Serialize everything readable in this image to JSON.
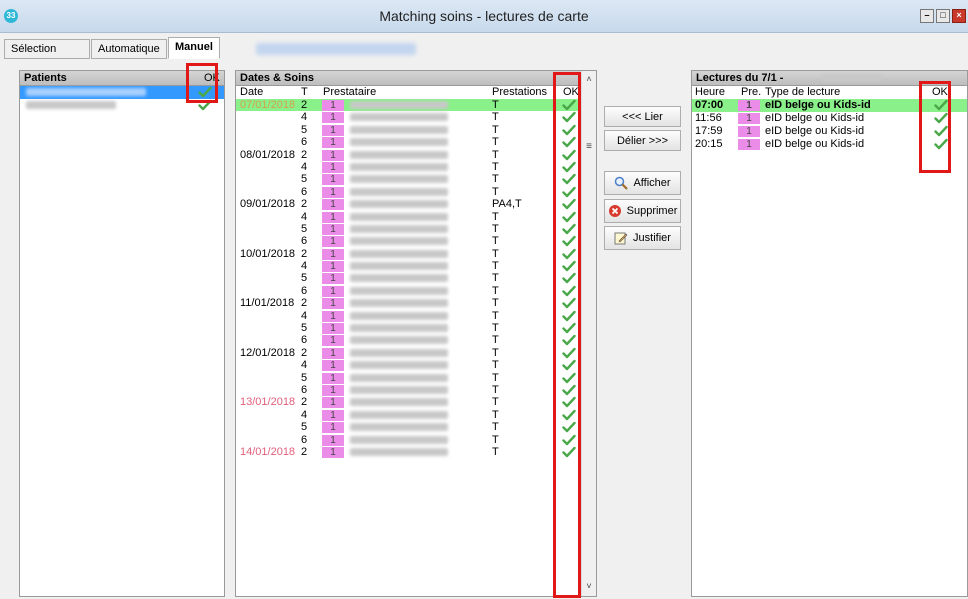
{
  "window": {
    "title": "Matching soins - lectures de carte",
    "icon_label": "33"
  },
  "tabs": [
    {
      "label": "Sélection"
    },
    {
      "label": "Automatique"
    },
    {
      "label": "Manuel",
      "active": true
    }
  ],
  "patients": {
    "header": "Patients",
    "ok_header": "OK",
    "rows": [
      {
        "ok": true,
        "selected": true
      },
      {
        "ok": true,
        "selected": false
      }
    ]
  },
  "soins": {
    "header": "Dates & Soins",
    "columns": {
      "date": "Date",
      "t": "T",
      "prestataire": "Prestataire",
      "prestations": "Prestations",
      "ok": "OK"
    },
    "rows": [
      {
        "date": "07/01/2018",
        "t": "2",
        "pre": "1",
        "prestations": "T",
        "date_color": "#d6a04a",
        "highlight": true
      },
      {
        "date": "",
        "t": "4",
        "pre": "1",
        "prestations": "T"
      },
      {
        "date": "",
        "t": "5",
        "pre": "1",
        "prestations": "T"
      },
      {
        "date": "",
        "t": "6",
        "pre": "1",
        "prestations": "T"
      },
      {
        "date": "08/01/2018",
        "t": "2",
        "pre": "1",
        "prestations": "T"
      },
      {
        "date": "",
        "t": "4",
        "pre": "1",
        "prestations": "T"
      },
      {
        "date": "",
        "t": "5",
        "pre": "1",
        "prestations": "T"
      },
      {
        "date": "",
        "t": "6",
        "pre": "1",
        "prestations": "T"
      },
      {
        "date": "09/01/2018",
        "t": "2",
        "pre": "1",
        "prestations": "PA4,T"
      },
      {
        "date": "",
        "t": "4",
        "pre": "1",
        "prestations": "T"
      },
      {
        "date": "",
        "t": "5",
        "pre": "1",
        "prestations": "T"
      },
      {
        "date": "",
        "t": "6",
        "pre": "1",
        "prestations": "T"
      },
      {
        "date": "10/01/2018",
        "t": "2",
        "pre": "1",
        "prestations": "T"
      },
      {
        "date": "",
        "t": "4",
        "pre": "1",
        "prestations": "T"
      },
      {
        "date": "",
        "t": "5",
        "pre": "1",
        "prestations": "T"
      },
      {
        "date": "",
        "t": "6",
        "pre": "1",
        "prestations": "T"
      },
      {
        "date": "11/01/2018",
        "t": "2",
        "pre": "1",
        "prestations": "T"
      },
      {
        "date": "",
        "t": "4",
        "pre": "1",
        "prestations": "T"
      },
      {
        "date": "",
        "t": "5",
        "pre": "1",
        "prestations": "T"
      },
      {
        "date": "",
        "t": "6",
        "pre": "1",
        "prestations": "T"
      },
      {
        "date": "12/01/2018",
        "t": "2",
        "pre": "1",
        "prestations": "T"
      },
      {
        "date": "",
        "t": "4",
        "pre": "1",
        "prestations": "T"
      },
      {
        "date": "",
        "t": "5",
        "pre": "1",
        "prestations": "T"
      },
      {
        "date": "",
        "t": "6",
        "pre": "1",
        "prestations": "T"
      },
      {
        "date": "13/01/2018",
        "t": "2",
        "pre": "1",
        "prestations": "T",
        "date_color": "#e0607a"
      },
      {
        "date": "",
        "t": "4",
        "pre": "1",
        "prestations": "T"
      },
      {
        "date": "",
        "t": "5",
        "pre": "1",
        "prestations": "T"
      },
      {
        "date": "",
        "t": "6",
        "pre": "1",
        "prestations": "T"
      },
      {
        "date": "14/01/2018",
        "t": "2",
        "pre": "1",
        "prestations": "T",
        "date_color": "#e0607a"
      }
    ]
  },
  "actions": {
    "lier": "<<< Lier",
    "delier": "Délier >>>",
    "afficher": "Afficher",
    "supprimer": "Supprimer",
    "justifier": "Justifier"
  },
  "lectures": {
    "header": "Lectures du 7/1 -",
    "columns": {
      "heure": "Heure",
      "pre": "Pre.",
      "type": "Type de lecture",
      "ok": "OK"
    },
    "rows": [
      {
        "heure": "07:00",
        "pre": "1",
        "type": "eID belge ou Kids-id",
        "highlight": true
      },
      {
        "heure": "11:56",
        "pre": "1",
        "type": "eID belge ou Kids-id"
      },
      {
        "heure": "17:59",
        "pre": "1",
        "type": "eID belge ou Kids-id"
      },
      {
        "heure": "20:15",
        "pre": "1",
        "type": "eID belge ou Kids-id"
      }
    ]
  },
  "colors": {
    "highlight_green": "#8af08a",
    "badge_pink": "#ea8ce8",
    "check_green": "#4aa84a",
    "annotation_red": "#e11818",
    "selection_blue": "#3399ff"
  }
}
